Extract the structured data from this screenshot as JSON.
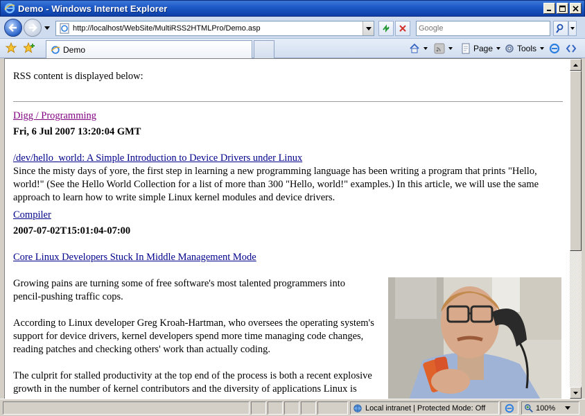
{
  "window": {
    "title": "Demo - Windows Internet Explorer"
  },
  "navbar": {
    "url": "http://localhost/WebSite/MultiRSS2HTMLPro/Demo.asp",
    "search_placeholder": "Google"
  },
  "tabs": [
    {
      "label": "Demo"
    }
  ],
  "commands": {
    "page": "Page",
    "tools": "Tools"
  },
  "content": {
    "intro": "RSS content is displayed below:",
    "feed_title": "Digg / Programming",
    "feed_date": "Fri, 6 Jul 2007 13:20:04 GMT",
    "item1_title": "/dev/hello_world: A Simple Introduction to Device Drivers under Linux",
    "item1_desc": "Since the misty days of yore, the first step in learning a new programming language has been writing a program that prints \"Hello, world!\" (See the Hello World Collection for a list of more than 300 \"Hello, world!\" examples.) In this article, we will use the same approach to learn how to write simple Linux kernel modules and device drivers.",
    "category": "Compiler",
    "item2_date": "2007-07-02T15:01:04-07:00",
    "item2_title": "Core Linux Developers Stuck In Middle Management Mode",
    "para1": "Growing pains are turning some of free software's most talented programmers into pencil-pushing traffic cops.",
    "para2": "According to Linux developer Greg Kroah-Hartman, who oversees the operating system's support for device drivers, kernel developers spend more time managing code changes, reading patches and checking others' work than actually coding.",
    "para3": "The culprit for stalled productivity at the top end of the process is both a recent explosive growth in the number of kernel contributors and the diversity of applications Linux is"
  },
  "status": {
    "zone": "Local intranet | Protected Mode: Off",
    "zoom": "100%"
  }
}
